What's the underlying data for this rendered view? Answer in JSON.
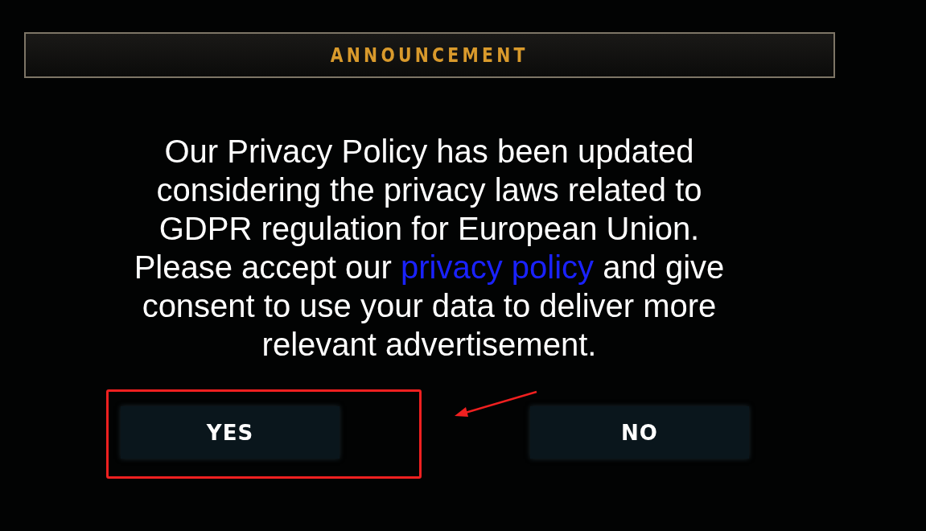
{
  "dialog": {
    "title": "ANNOUNCEMENT",
    "message": {
      "before": "Our Privacy Policy has been updated considering the privacy laws related to GDPR regulation for European Union. Please accept our ",
      "link": "privacy policy",
      "after": " and give consent to use your data to deliver more relevant advertisement."
    },
    "buttons": [
      {
        "label": "YES",
        "highlighted": true
      },
      {
        "label": "NO",
        "highlighted": false
      }
    ]
  }
}
